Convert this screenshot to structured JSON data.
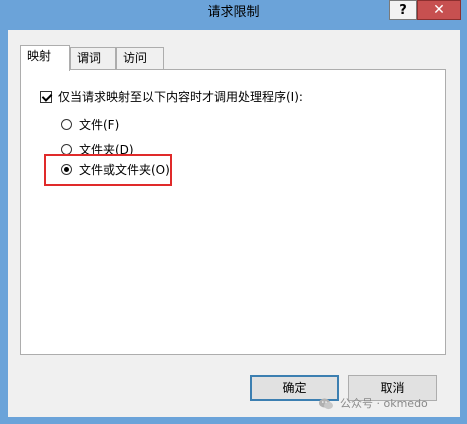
{
  "window": {
    "title": "请求限制",
    "help_label": "?",
    "close_label": "✕"
  },
  "tabs": [
    {
      "label": "映射",
      "active": true
    },
    {
      "label": "谓词",
      "active": false
    },
    {
      "label": "访问",
      "active": false
    }
  ],
  "mapping": {
    "checkbox_label": "仅当请求映射至以下内容时才调用处理程序(I):",
    "checkbox_checked": true,
    "options": [
      {
        "label": "文件(F)",
        "selected": false
      },
      {
        "label": "文件夹(D)",
        "selected": false
      },
      {
        "label": "文件或文件夹(O)",
        "selected": true
      }
    ]
  },
  "buttons": {
    "ok_label": "确定",
    "cancel_label": "取消"
  },
  "watermark": {
    "text": "公众号 · okmedo"
  }
}
